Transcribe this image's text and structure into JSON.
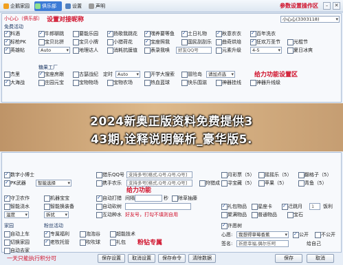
{
  "toolbar": {
    "items": [
      {
        "label": "企鹅家园",
        "color": "#f0a020"
      },
      {
        "label": "俱乐部",
        "color": "#40a040"
      },
      {
        "label": "设置",
        "color": "#5080c0"
      },
      {
        "label": "声明",
        "color": "#808080"
      }
    ],
    "title": "参数设置操作区",
    "minimize": "–",
    "close": "✕"
  },
  "top": {
    "user_tabs": "小心心（俱乐部）",
    "set_nickname": "设置对接昵称",
    "account": "小心心(3303118)"
  },
  "free": {
    "heading": "免费活动",
    "rows": [
      [
        "料酒",
        "牛郎聊跳",
        "要能乐园",
        "扬歌我跳花",
        "嘿养要等鱼",
        "土日礼物",
        "秋意农衣",
        "百年洗衣"
      ],
      [
        "标枪PK",
        "宝贝比拼",
        "宝贝小牌",
        "小猎荷花",
        "宝座照我",
        "国民刮刮乐",
        "曲奇烘焙",
        "狂欢万圣节",
        "光棍节"
      ],
      [
        "英雄帖",
        "",
        "地理达人",
        "消耗抗膜值",
        "表录我唤",
        "好友QQ号",
        "",
        "元素升级",
        "",
        "夏日冰爽"
      ]
    ],
    "auto_label": "Auto",
    "select_4_5": "4-5"
  },
  "middle": {
    "section": "糖果工厂",
    "rows": [
      [
        "杰里",
        "宝座房跟",
        "古瑟战纪",
        "定时",
        "开学大搜索",
        "冒险岛",
        "请加点选"
      ],
      [
        "大海战",
        "庄园元宝",
        "宝物物场",
        "宝物农场",
        "热血蓝球",
        "快乐围滋",
        "神器挂线",
        "神器升线级"
      ]
    ],
    "auto2": "Auto",
    "right_title": "给力功能设置区"
  },
  "banner": {
    "line1": "2024新奥正版资料免费提供3",
    "line2": "43期,诠释说明解析_豪华版5."
  },
  "lower": {
    "group_title": "数字小博士",
    "pk_label": "PK武器",
    "smart_select": "智能选择",
    "qq_label": "猎乐QQ号",
    "multi_hint": "支持多号[格式,Q号,Q号,Q号]",
    "xieyi_label": "携手农乐",
    "hunt_label": "狩猎成",
    "right_col": [
      "月彩票（5）",
      "摇摇乐（5）",
      "翻格子（5）"
    ],
    "right_col2": [
      "寻宝藏（5）"
    ],
    "right_col3": [
      "苹果（5）",
      "青鱼（5）"
    ]
  },
  "bottom": {
    "left_items": [
      "守卫农作",
      "智能浇水",
      "温度",
      "家园"
    ],
    "mid_items": [
      "机器宝宝",
      "智能换装备",
      "拆扰"
    ],
    "auto_hunt": "自动打猎",
    "auto_cut": "自动砍树",
    "interval": "间隔",
    "seconds": "秒",
    "clear_grass": "除草抽藤",
    "interact": "互动种水",
    "give_label": "好友号，打勾不填则自用",
    "power_title": "给力功能",
    "gift_items": [
      "礼包物品",
      "星座卡",
      "迁跳月",
      "饭利"
    ],
    "gift_items2": [
      "聚满物品",
      "普通物品",
      "宝石"
    ],
    "qty": "1",
    "fan_title": "粉丝活动",
    "fan_items": [
      "专属福利",
      "泡泡谷",
      "超能技术"
    ],
    "fan_items2": [
      "老牧托管",
      "吹吹球",
      "礼包"
    ],
    "fan_center": "粉钻专属",
    "home_items": [
      "自动上车",
      "切换家园",
      "自动去家"
    ],
    "home_pick": "智能选择",
    "permit": "许愿树",
    "heart_label": "心愿:",
    "heart_value": "我想得草莓香蕉",
    "public": "公开",
    "anonymous": "不公开",
    "signature_label": "签名:",
    "signature_value": "祈愿幸福,偶尔乐呵",
    "author": "给自己",
    "banner_red": "一天只能执行积分可",
    "buttons": [
      "保存设置",
      "取消设置",
      "保存命令",
      "清除数据",
      "保存",
      "取消"
    ]
  },
  "colors": {
    "accent": "#3c7bd6",
    "red": "#d0102a"
  }
}
